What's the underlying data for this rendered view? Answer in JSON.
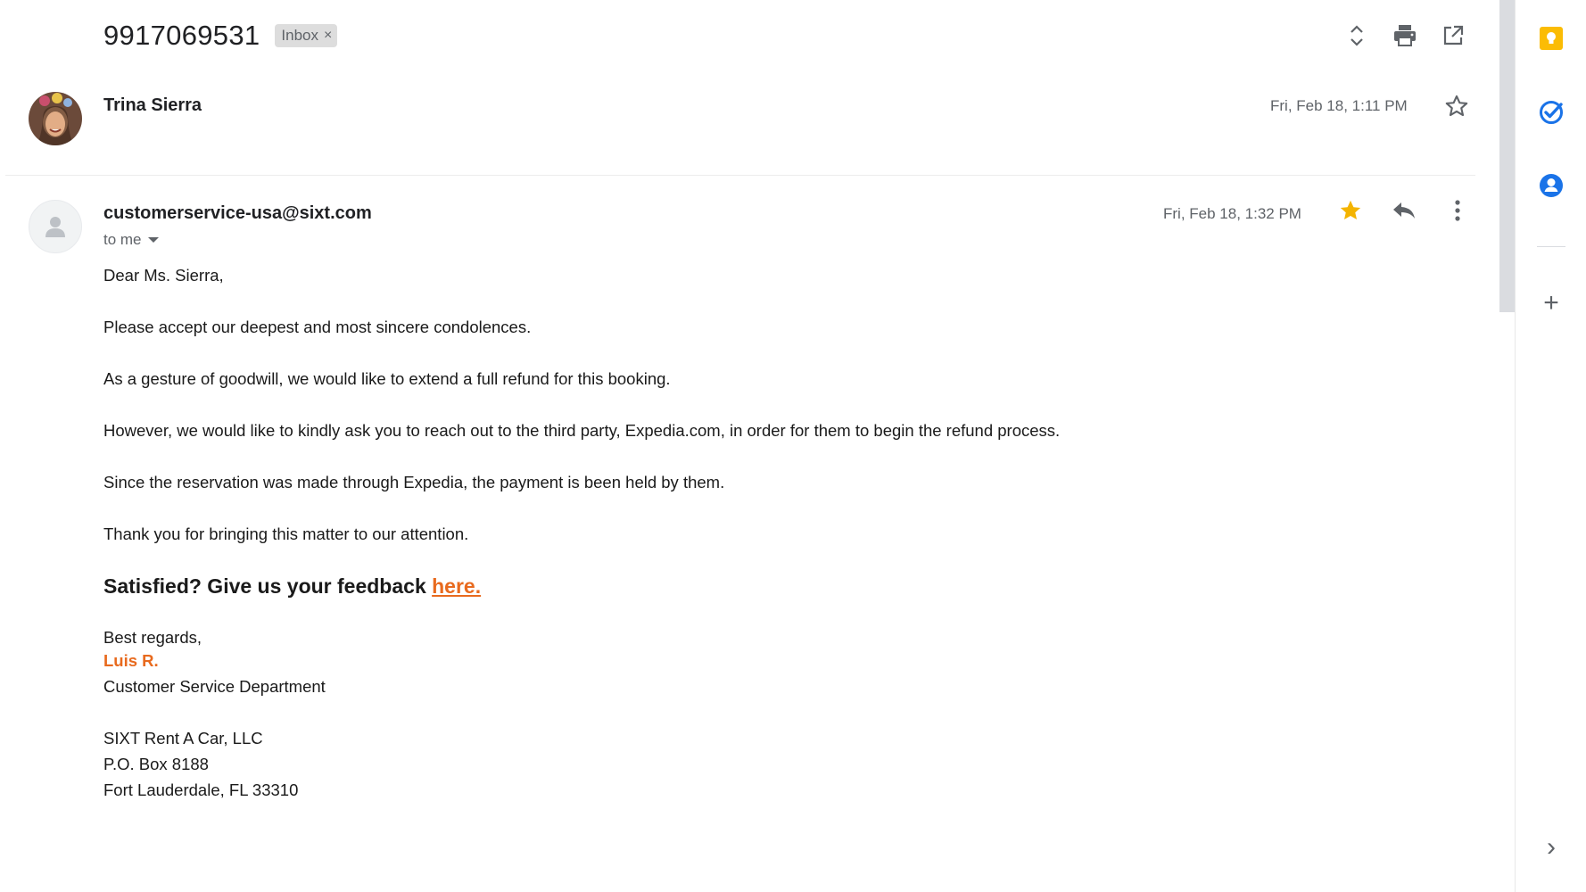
{
  "thread": {
    "subject": "9917069531",
    "label": "Inbox",
    "label_remove": "×"
  },
  "toolbar_icons": [
    "expand-collapse-icon",
    "print-icon",
    "open-new-window-icon"
  ],
  "message1": {
    "sender": "Trina Sierra",
    "date": "Fri, Feb 18, 1:11 PM",
    "starred": false
  },
  "message2": {
    "sender": "customerservice-usa@sixt.com",
    "recipient": "to me",
    "date": "Fri, Feb 18, 1:32 PM",
    "starred": true,
    "body": {
      "greeting": "Dear Ms. Sierra,",
      "p1": "Please accept our deepest and most sincere condolences.",
      "p2": "As a gesture of goodwill, we would like to extend a full refund for this booking.",
      "p3": "However, we would like to kindly ask you to reach out to the third party, Expedia.com, in order for them to begin the refund process.",
      "p4": "Since the reservation was made through Expedia, the payment is been held by them.",
      "p5": "Thank you for bringing this matter to our attention.",
      "feedback_text": "Satisfied? Give us your feedback ",
      "feedback_link": "here.",
      "closing": "Best regards,",
      "sig_name": "Luis R.",
      "sig_dept": "Customer Service Department",
      "company": "SIXT Rent A Car, LLC",
      "po_box": "P.O. Box 8188",
      "city": "Fort Lauderdale, FL 33310"
    }
  },
  "side_panel": {
    "apps": [
      "keep-icon",
      "tasks-icon",
      "contacts-icon"
    ],
    "add": "+",
    "collapse": "›"
  },
  "colors": {
    "accent_orange": "#e86a1e",
    "star_yellow": "#f4b400",
    "keep_yellow": "#fbbc04",
    "blue": "#1a73e8"
  }
}
